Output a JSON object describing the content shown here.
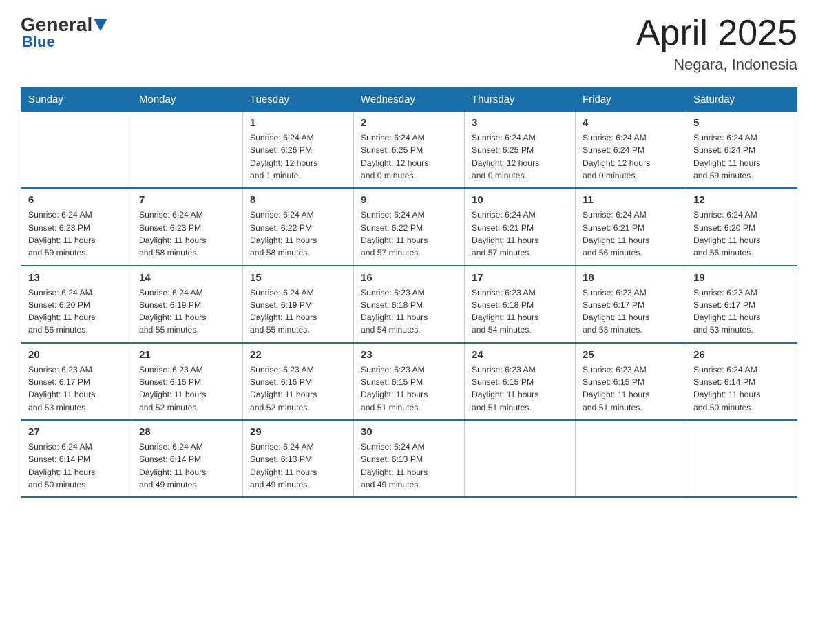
{
  "header": {
    "logo_general": "General",
    "logo_blue": "Blue",
    "month": "April 2025",
    "location": "Negara, Indonesia"
  },
  "days_of_week": [
    "Sunday",
    "Monday",
    "Tuesday",
    "Wednesday",
    "Thursday",
    "Friday",
    "Saturday"
  ],
  "weeks": [
    [
      {
        "day": "",
        "info": ""
      },
      {
        "day": "",
        "info": ""
      },
      {
        "day": "1",
        "info": "Sunrise: 6:24 AM\nSunset: 6:26 PM\nDaylight: 12 hours\nand 1 minute."
      },
      {
        "day": "2",
        "info": "Sunrise: 6:24 AM\nSunset: 6:25 PM\nDaylight: 12 hours\nand 0 minutes."
      },
      {
        "day": "3",
        "info": "Sunrise: 6:24 AM\nSunset: 6:25 PM\nDaylight: 12 hours\nand 0 minutes."
      },
      {
        "day": "4",
        "info": "Sunrise: 6:24 AM\nSunset: 6:24 PM\nDaylight: 12 hours\nand 0 minutes."
      },
      {
        "day": "5",
        "info": "Sunrise: 6:24 AM\nSunset: 6:24 PM\nDaylight: 11 hours\nand 59 minutes."
      }
    ],
    [
      {
        "day": "6",
        "info": "Sunrise: 6:24 AM\nSunset: 6:23 PM\nDaylight: 11 hours\nand 59 minutes."
      },
      {
        "day": "7",
        "info": "Sunrise: 6:24 AM\nSunset: 6:23 PM\nDaylight: 11 hours\nand 58 minutes."
      },
      {
        "day": "8",
        "info": "Sunrise: 6:24 AM\nSunset: 6:22 PM\nDaylight: 11 hours\nand 58 minutes."
      },
      {
        "day": "9",
        "info": "Sunrise: 6:24 AM\nSunset: 6:22 PM\nDaylight: 11 hours\nand 57 minutes."
      },
      {
        "day": "10",
        "info": "Sunrise: 6:24 AM\nSunset: 6:21 PM\nDaylight: 11 hours\nand 57 minutes."
      },
      {
        "day": "11",
        "info": "Sunrise: 6:24 AM\nSunset: 6:21 PM\nDaylight: 11 hours\nand 56 minutes."
      },
      {
        "day": "12",
        "info": "Sunrise: 6:24 AM\nSunset: 6:20 PM\nDaylight: 11 hours\nand 56 minutes."
      }
    ],
    [
      {
        "day": "13",
        "info": "Sunrise: 6:24 AM\nSunset: 6:20 PM\nDaylight: 11 hours\nand 56 minutes."
      },
      {
        "day": "14",
        "info": "Sunrise: 6:24 AM\nSunset: 6:19 PM\nDaylight: 11 hours\nand 55 minutes."
      },
      {
        "day": "15",
        "info": "Sunrise: 6:24 AM\nSunset: 6:19 PM\nDaylight: 11 hours\nand 55 minutes."
      },
      {
        "day": "16",
        "info": "Sunrise: 6:23 AM\nSunset: 6:18 PM\nDaylight: 11 hours\nand 54 minutes."
      },
      {
        "day": "17",
        "info": "Sunrise: 6:23 AM\nSunset: 6:18 PM\nDaylight: 11 hours\nand 54 minutes."
      },
      {
        "day": "18",
        "info": "Sunrise: 6:23 AM\nSunset: 6:17 PM\nDaylight: 11 hours\nand 53 minutes."
      },
      {
        "day": "19",
        "info": "Sunrise: 6:23 AM\nSunset: 6:17 PM\nDaylight: 11 hours\nand 53 minutes."
      }
    ],
    [
      {
        "day": "20",
        "info": "Sunrise: 6:23 AM\nSunset: 6:17 PM\nDaylight: 11 hours\nand 53 minutes."
      },
      {
        "day": "21",
        "info": "Sunrise: 6:23 AM\nSunset: 6:16 PM\nDaylight: 11 hours\nand 52 minutes."
      },
      {
        "day": "22",
        "info": "Sunrise: 6:23 AM\nSunset: 6:16 PM\nDaylight: 11 hours\nand 52 minutes."
      },
      {
        "day": "23",
        "info": "Sunrise: 6:23 AM\nSunset: 6:15 PM\nDaylight: 11 hours\nand 51 minutes."
      },
      {
        "day": "24",
        "info": "Sunrise: 6:23 AM\nSunset: 6:15 PM\nDaylight: 11 hours\nand 51 minutes."
      },
      {
        "day": "25",
        "info": "Sunrise: 6:23 AM\nSunset: 6:15 PM\nDaylight: 11 hours\nand 51 minutes."
      },
      {
        "day": "26",
        "info": "Sunrise: 6:24 AM\nSunset: 6:14 PM\nDaylight: 11 hours\nand 50 minutes."
      }
    ],
    [
      {
        "day": "27",
        "info": "Sunrise: 6:24 AM\nSunset: 6:14 PM\nDaylight: 11 hours\nand 50 minutes."
      },
      {
        "day": "28",
        "info": "Sunrise: 6:24 AM\nSunset: 6:14 PM\nDaylight: 11 hours\nand 49 minutes."
      },
      {
        "day": "29",
        "info": "Sunrise: 6:24 AM\nSunset: 6:13 PM\nDaylight: 11 hours\nand 49 minutes."
      },
      {
        "day": "30",
        "info": "Sunrise: 6:24 AM\nSunset: 6:13 PM\nDaylight: 11 hours\nand 49 minutes."
      },
      {
        "day": "",
        "info": ""
      },
      {
        "day": "",
        "info": ""
      },
      {
        "day": "",
        "info": ""
      }
    ]
  ]
}
